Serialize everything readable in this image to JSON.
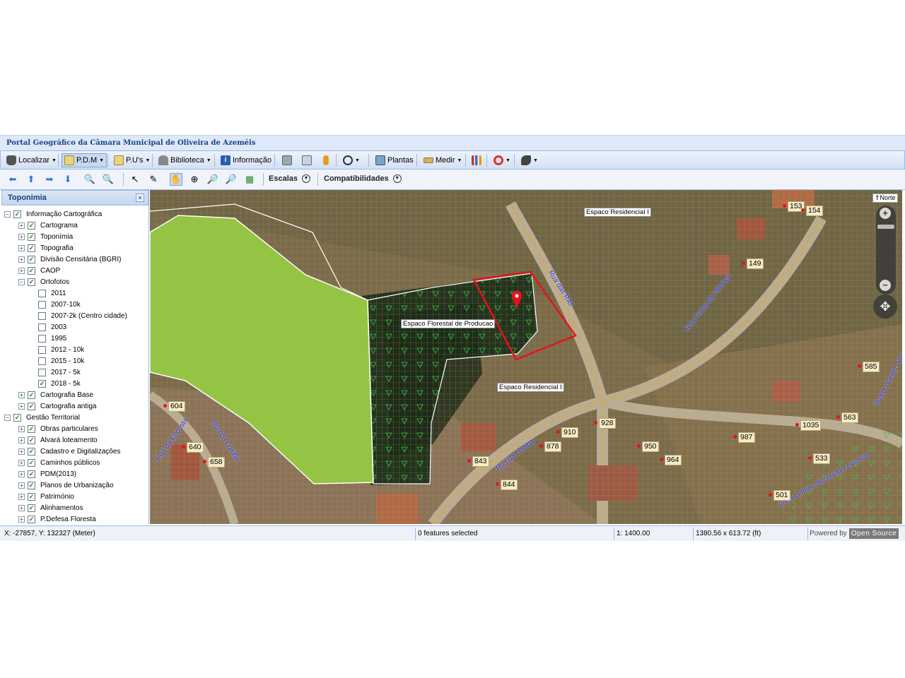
{
  "app": {
    "title": "Portal Geográfico da Câmara Municipal de Oliveira de Azeméis"
  },
  "toolbar": {
    "items": [
      {
        "label": "Localizar",
        "icon": "binoculars-icon"
      },
      {
        "label": "P.D.M",
        "icon": "map-document-icon",
        "pressed": true
      },
      {
        "label": "P.U's",
        "icon": "map-document-icon"
      },
      {
        "label": "Biblioteca",
        "icon": "library-icon"
      },
      {
        "label": "Informação",
        "icon": "info-icon"
      },
      {
        "label": "",
        "icon": "print-icon"
      },
      {
        "label": "",
        "icon": "scanner-icon"
      },
      {
        "label": "",
        "icon": "street-view-person-icon"
      },
      {
        "label": "",
        "icon": "gps-target-icon"
      },
      {
        "label": "Plantas",
        "icon": "plantas-icon"
      },
      {
        "label": "Medir",
        "icon": "ruler-icon"
      },
      {
        "label": "",
        "icon": "bar-chart-icon"
      },
      {
        "label": "",
        "icon": "lifebuoy-icon"
      },
      {
        "label": "",
        "icon": "tools-icon"
      }
    ]
  },
  "navbar": {
    "tools": [
      "arrow-left-icon",
      "arrow-up-icon",
      "arrow-right-icon",
      "arrow-down-icon",
      "zoom-extent-icon",
      "zoom-previous-icon",
      "select-arrow-icon",
      "edit-brush-icon",
      "pan-hand-icon",
      "zoom-box-icon",
      "zoom-in-icon",
      "zoom-out-icon",
      "identify-icon"
    ],
    "scales_label": "Escalas",
    "compat_label": "Compatibilidades"
  },
  "panel": {
    "title": "Toponimia",
    "tree": [
      {
        "label": "Informação Cartográfica",
        "level": 0,
        "expander": "−",
        "checked": true
      },
      {
        "label": "Cartograma",
        "level": 1,
        "expander": "+",
        "checked": true
      },
      {
        "label": "Toponímia",
        "level": 1,
        "expander": "+",
        "checked": true
      },
      {
        "label": "Topografia",
        "level": 1,
        "expander": "+",
        "checked": true
      },
      {
        "label": "Divisão Censitária (BGRI)",
        "level": 1,
        "expander": "+",
        "checked": true
      },
      {
        "label": "CAOP",
        "level": 1,
        "expander": "+",
        "checked": true
      },
      {
        "label": "Ortofotos",
        "level": 1,
        "expander": "−",
        "checked": true
      },
      {
        "label": "2011",
        "level": 2,
        "expander": "",
        "checked": false
      },
      {
        "label": "2007-10k",
        "level": 2,
        "expander": "",
        "checked": false
      },
      {
        "label": "2007-2k (Centro cidade)",
        "level": 2,
        "expander": "",
        "checked": false
      },
      {
        "label": "2003",
        "level": 2,
        "expander": "",
        "checked": false
      },
      {
        "label": "1995",
        "level": 2,
        "expander": "",
        "checked": false
      },
      {
        "label": "2012 - 10k",
        "level": 2,
        "expander": "",
        "checked": false
      },
      {
        "label": "2015 - 10k",
        "level": 2,
        "expander": "",
        "checked": false
      },
      {
        "label": "2017 - 5k",
        "level": 2,
        "expander": "",
        "checked": false
      },
      {
        "label": "2018 - 5k",
        "level": 2,
        "expander": "",
        "checked": true
      },
      {
        "label": "Cartografia Base",
        "level": 1,
        "expander": "+",
        "checked": true
      },
      {
        "label": "Cartografia antiga",
        "level": 1,
        "expander": "+",
        "checked": true
      },
      {
        "label": "Gestão Territorial",
        "level": 0,
        "expander": "−",
        "checked": true
      },
      {
        "label": "Obras particulares",
        "level": 1,
        "expander": "+",
        "checked": true
      },
      {
        "label": "Alvará loteamento",
        "level": 1,
        "expander": "+",
        "checked": true
      },
      {
        "label": "Cadastro e Digitalizações",
        "level": 1,
        "expander": "+",
        "checked": true
      },
      {
        "label": "Caminhos públicos",
        "level": 1,
        "expander": "+",
        "checked": true
      },
      {
        "label": "PDM(2013)",
        "level": 1,
        "expander": "+",
        "checked": true
      },
      {
        "label": "Planos de Urbanização",
        "level": 1,
        "expander": "+",
        "checked": true
      },
      {
        "label": "Património",
        "level": 1,
        "expander": "+",
        "checked": true
      },
      {
        "label": "Alinhamentos",
        "level": 1,
        "expander": "+",
        "checked": true
      },
      {
        "label": "P.Defesa Floresta",
        "level": 1,
        "expander": "+",
        "checked": true
      }
    ]
  },
  "map": {
    "north_label": "Norte",
    "zone_labels": [
      "Espaco Residencial I",
      "Espaco Florestal de Producao",
      "Espaco Residencial I"
    ],
    "streets": [
      "Rua das Rãs",
      "Rua Fonte da Valença",
      "Rua do Centro Vidreiro",
      "Rua da Encosta",
      "Rua da Lomba",
      "Rua da Lomba",
      "Rodovia Rede distribuidora existente"
    ],
    "house_numbers": [
      "153",
      "154",
      "149",
      "585",
      "604",
      "928",
      "910",
      "878",
      "640",
      "658",
      "843",
      "844",
      "950",
      "964",
      "987",
      "1035",
      "563",
      "533",
      "501"
    ]
  },
  "status": {
    "coords": "X: -27857, Y: 132327 (Meter)",
    "selection": "0 features selected",
    "scale": "1: 1400.00",
    "extent": "1380.56 x 613.72 (ft)",
    "powered_by": "Powered by",
    "open_source": "Open Source"
  }
}
